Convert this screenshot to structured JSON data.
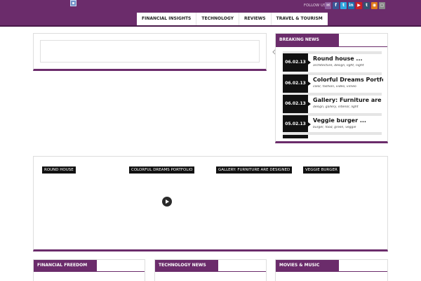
{
  "header": {
    "follow_label": "FOLLOW US",
    "social_icons": [
      "mail-icon",
      "facebook-icon",
      "twitter-icon",
      "linkedin-icon",
      "youtube-icon",
      "tumblr-icon",
      "rss-icon",
      "share-icon"
    ],
    "social_glyphs": {
      "mail": "✉",
      "facebook": "f",
      "twitter": "t",
      "linkedin": "in",
      "youtube": "▶",
      "tumblr": "t",
      "rss": "◉",
      "share": "▢"
    }
  },
  "nav": {
    "items": [
      {
        "label": "FINANCIAL INSIGHTS"
      },
      {
        "label": "TECHNOLOGY"
      },
      {
        "label": "REVIEWS"
      },
      {
        "label": "TRAVEL & TOURISM"
      }
    ]
  },
  "breaking_news": {
    "title": "BREAKING NEWS",
    "items": [
      {
        "date": "06.02.13",
        "headline": "Round house ...",
        "tags": "architecture, design, light, night"
      },
      {
        "date": "06.02.13",
        "headline": "Colorful Dreams Portfo",
        "tags": "color, fashion, video, vimeo"
      },
      {
        "date": "06.02.13",
        "headline": "Gallery: Furniture are",
        "tags": "design, gallery, interior, light"
      },
      {
        "date": "05.02.13",
        "headline": "Veggie burger ...",
        "tags": "burger, food, green, veggie"
      }
    ]
  },
  "gallery": {
    "labels": [
      "ROUND HOUSE",
      "COLORFUL DREAMS PORTFOLIO",
      "GALLERY: FURNITURE ARE DESIGNED",
      "VEGGIE BURGER"
    ]
  },
  "categories": [
    {
      "title": "FINANCIAL FREEDOM"
    },
    {
      "title": "TECHNOLOGY NEWS"
    },
    {
      "title": "MOVIES & MUSIC"
    }
  ],
  "colors": {
    "brand_purple": "#6b2c6b",
    "date_black": "#111111"
  }
}
